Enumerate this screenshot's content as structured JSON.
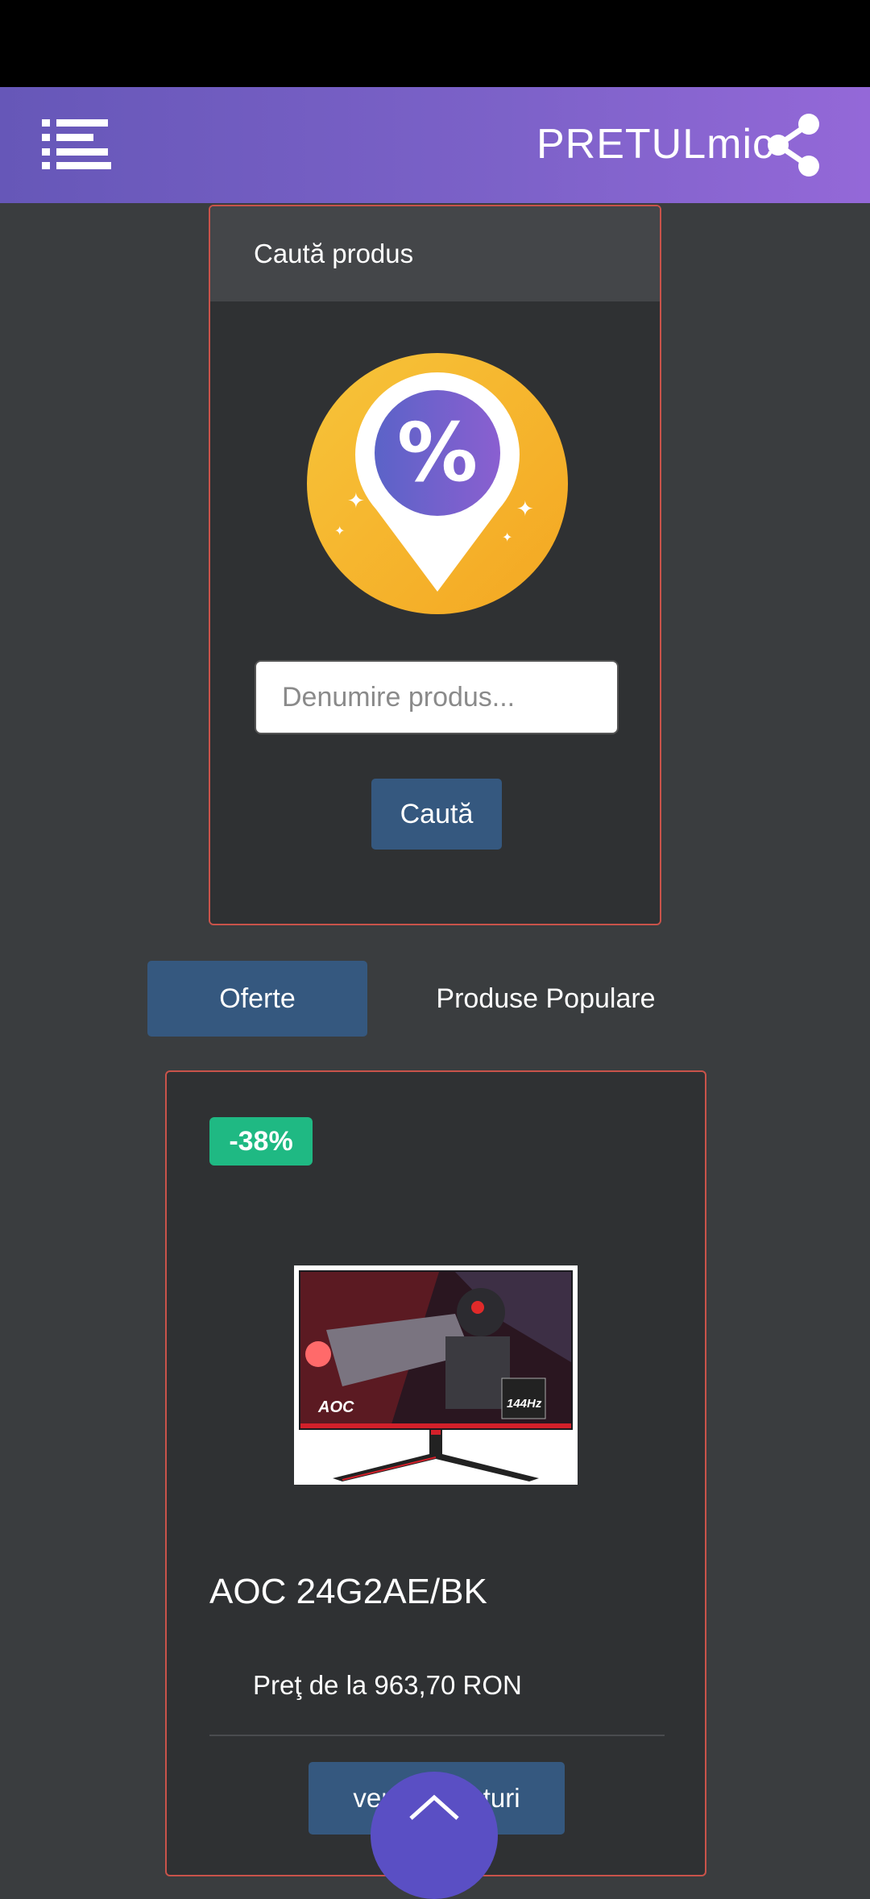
{
  "appbar": {
    "brand": "PRETULmic",
    "menu_icon": "list-menu-icon",
    "share_icon": "share-icon",
    "gradient": [
      "#6657b8",
      "#9468d8"
    ]
  },
  "search": {
    "title": "Caută produs",
    "badge_icon": "percent-location-pin-icon",
    "input_value": "",
    "input_placeholder": "Denumire produs...",
    "button_label": "Caută"
  },
  "tabs": [
    {
      "label": "Oferte",
      "active": true
    },
    {
      "label": "Produse Populare",
      "active": false
    }
  ],
  "product": {
    "discount": "-38%",
    "image": "AOC gaming monitor product photo",
    "image_brand_text": "AOC",
    "image_refresh_text": "144Hz",
    "name": "AOC 24G2AE/BK",
    "price": "Preţ de la 963,70 RON",
    "button_label": "verifică preţuri"
  },
  "scroll_top_icon": "chevron-up-icon",
  "colors": {
    "background": "#3a3d3f",
    "card": "#2f3133",
    "card_border": "#c9534a",
    "primary_button": "#35587f",
    "discount_badge": "#1fb983",
    "fab": "#5a4fc4"
  }
}
